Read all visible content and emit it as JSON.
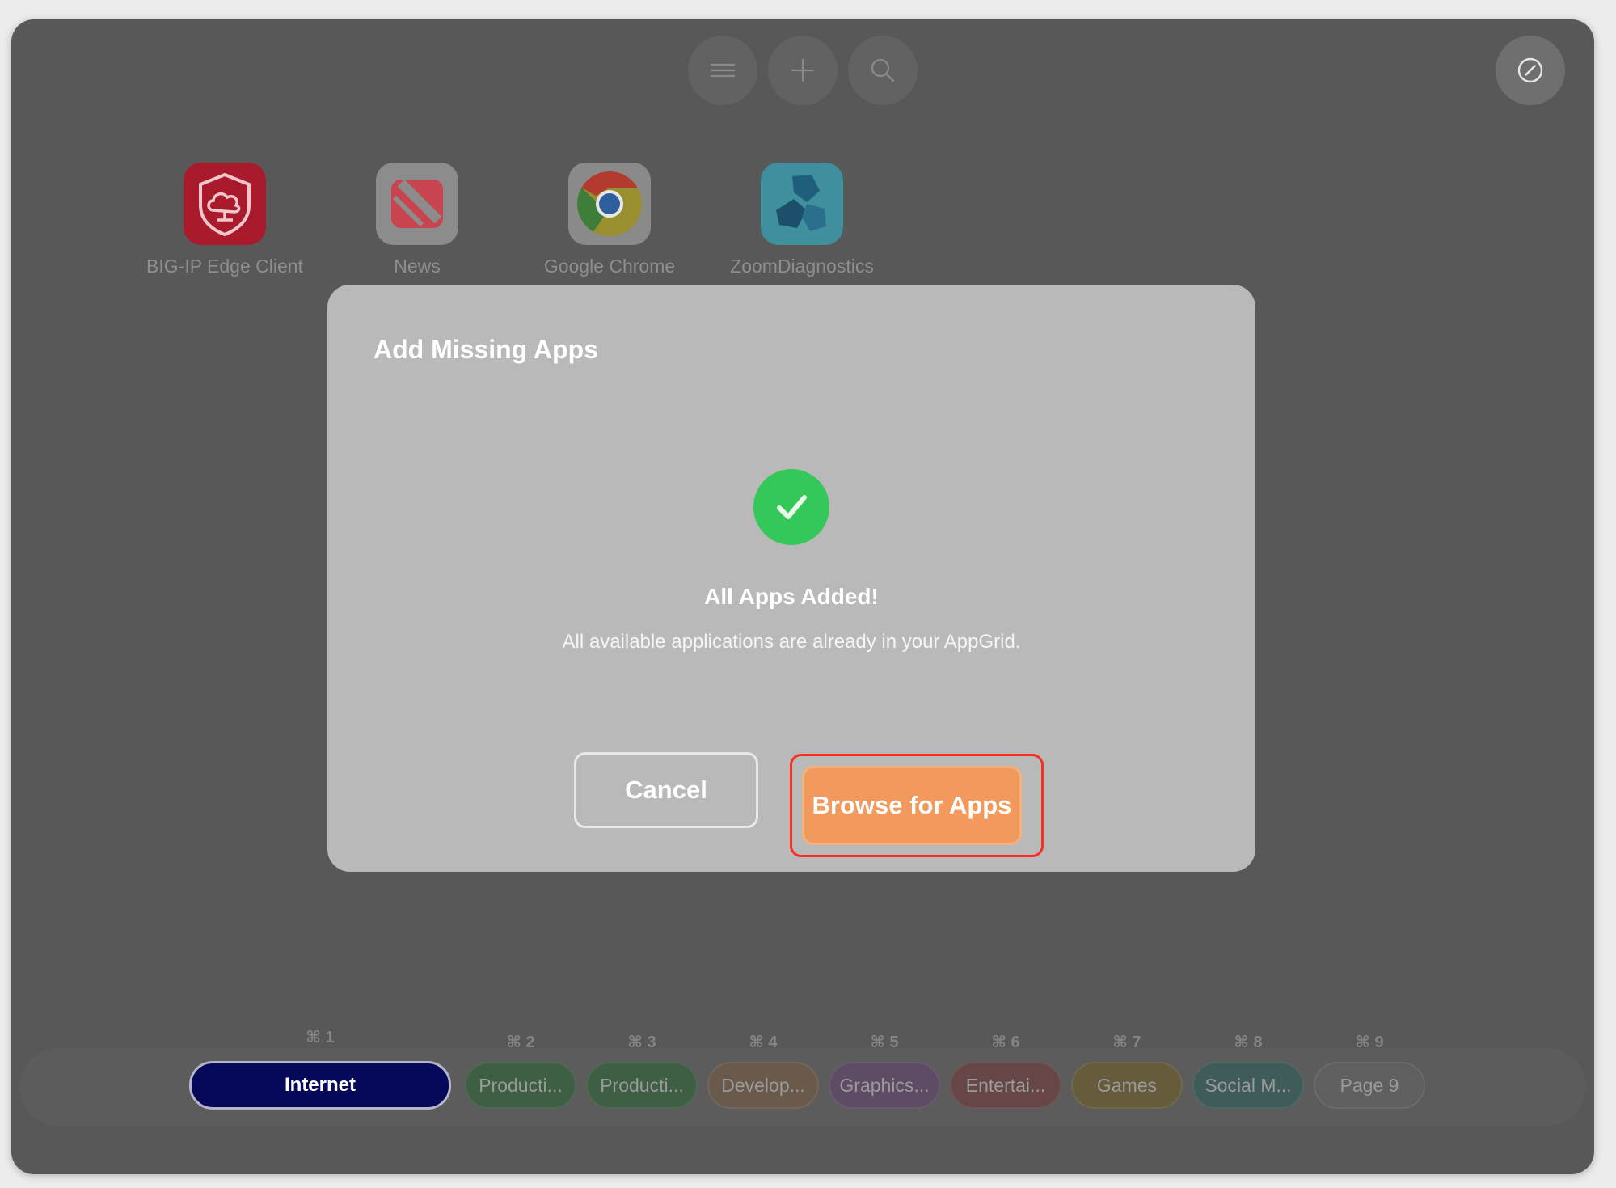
{
  "toolbar": {
    "icons": [
      "menu-icon",
      "plus-icon",
      "search-icon",
      "edit-icon"
    ]
  },
  "apps": [
    {
      "label": "BIG-IP Edge Client",
      "icon": "shield-cloud-icon"
    },
    {
      "label": "News",
      "icon": "news-icon"
    },
    {
      "label": "Google Chrome",
      "icon": "chrome-icon"
    },
    {
      "label": "ZoomDiagnostics",
      "icon": "zoom-diagnostics-icon"
    }
  ],
  "modal": {
    "title": "Add Missing Apps",
    "heading": "All Apps Added!",
    "message": "All available applications are already in your AppGrid.",
    "cancel_label": "Cancel",
    "browse_label": "Browse for Apps"
  },
  "tabs": [
    {
      "shortcut": "⌘ 1",
      "label": "Internet",
      "color": "#06085a",
      "active": true
    },
    {
      "shortcut": "⌘ 2",
      "label": "Producti...",
      "color": "#3f5f44"
    },
    {
      "shortcut": "⌘ 3",
      "label": "Producti...",
      "color": "#3f5f44"
    },
    {
      "shortcut": "⌘ 4",
      "label": "Develop...",
      "color": "#6a5a4c"
    },
    {
      "shortcut": "⌘ 5",
      "label": "Graphics...",
      "color": "#5e4c64"
    },
    {
      "shortcut": "⌘ 6",
      "label": "Entertai...",
      "color": "#664646"
    },
    {
      "shortcut": "⌘ 7",
      "label": "Games",
      "color": "#665c3c"
    },
    {
      "shortcut": "⌘ 8",
      "label": "Social M...",
      "color": "#3f5c5a"
    },
    {
      "shortcut": "⌘ 9",
      "label": "Page 9",
      "color": "#5f5f5f"
    }
  ],
  "colors": {
    "accent": "#f29a5d",
    "success": "#34c759",
    "highlight": "#ff2d20"
  }
}
